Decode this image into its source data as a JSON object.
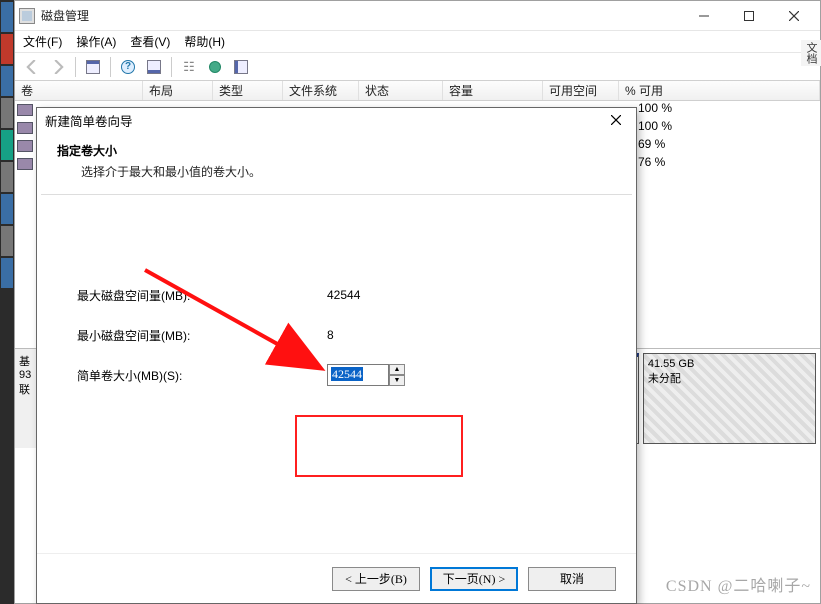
{
  "window": {
    "title": "磁盘管理"
  },
  "menu": {
    "file": "文件(F)",
    "action": "操作(A)",
    "view": "查看(V)",
    "help": "帮助(H)"
  },
  "columns": {
    "vol": "卷",
    "layout": "布局",
    "type": "类型",
    "fs": "文件系统",
    "status": "状态",
    "capacity": "容量",
    "free": "可用空间",
    "pct": "% 可用"
  },
  "pct_rows": [
    "100 %",
    "100 %",
    "69 %",
    "76 %"
  ],
  "disk_lower": {
    "left1": "基",
    "left2": "93",
    "left3": "联",
    "unalloc_size": "41.55 GB",
    "unalloc_label": "未分配"
  },
  "dialog": {
    "title": "新建简单卷向导",
    "heading": "指定卷大小",
    "subheading": "选择介于最大和最小值的卷大小。",
    "max_label": "最大磁盘空间量(MB):",
    "max_value": "42544",
    "min_label": "最小磁盘空间量(MB):",
    "min_value": "8",
    "size_label": "简单卷大小(MB)(S):",
    "size_value": "42544",
    "back": "< 上一步(B)",
    "next": "下一页(N) >",
    "cancel": "取消"
  },
  "watermark": "CSDN @二哈喇子~",
  "side_text": "文档"
}
